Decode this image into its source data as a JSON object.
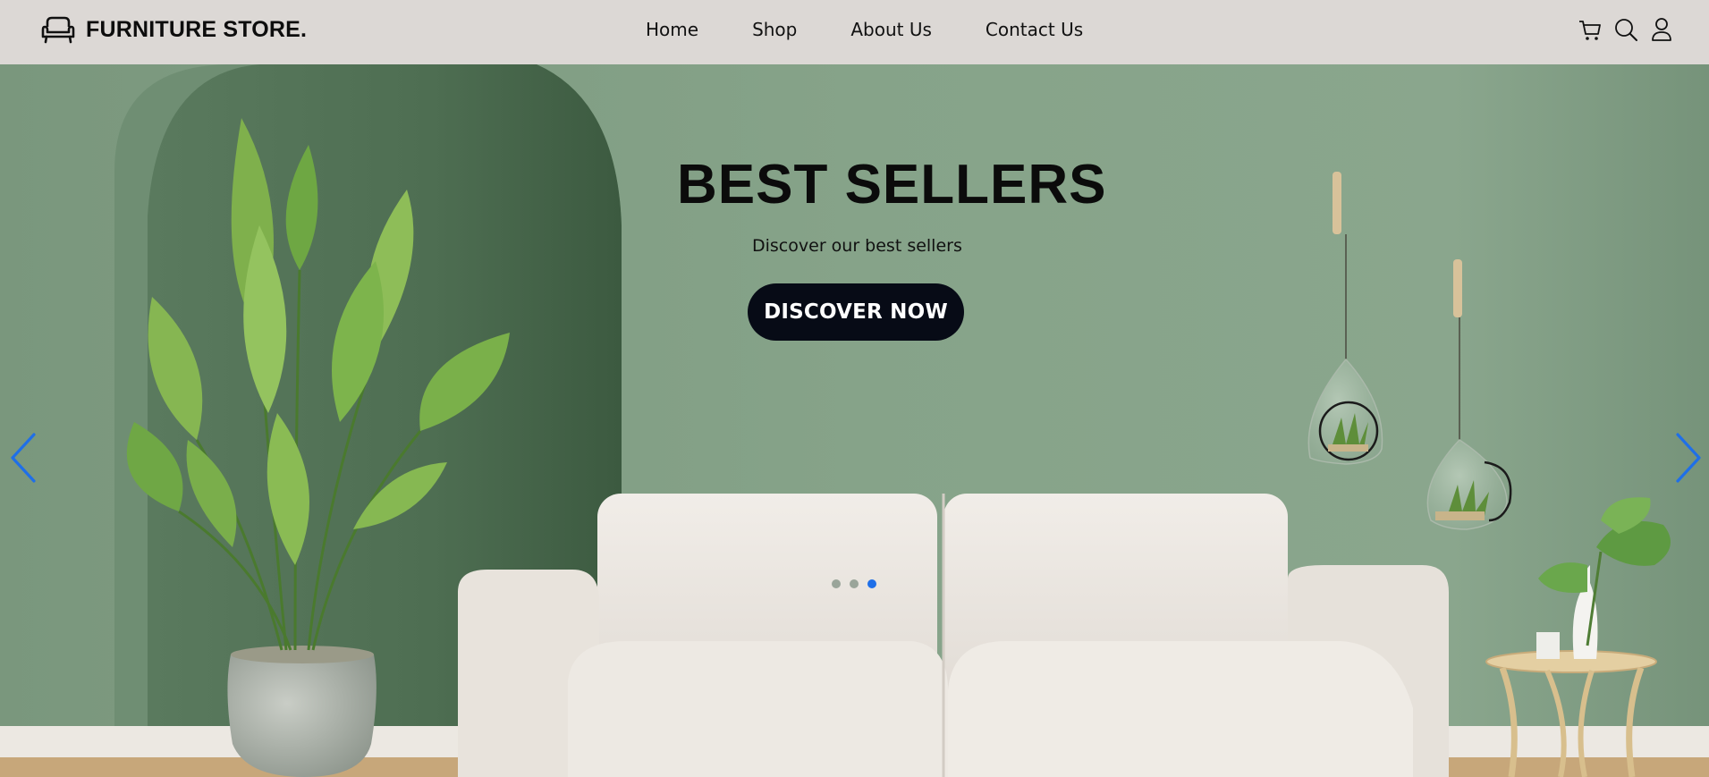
{
  "brand": {
    "name": "FURNITURE STORE."
  },
  "nav": {
    "links": [
      {
        "label": "Home"
      },
      {
        "label": "Shop"
      },
      {
        "label": "About Us"
      },
      {
        "label": "Contact Us"
      }
    ],
    "icons": [
      "cart-icon",
      "search-icon",
      "user-icon"
    ]
  },
  "hero": {
    "title": "BEST SELLERS",
    "subtitle": "Discover our best sellers",
    "cta_label": "DISCOVER NOW",
    "slide_count": 3,
    "active_slide": 3
  },
  "colors": {
    "navbar_bg": "#dcd8d5",
    "wall_green": "#7f9c82",
    "cta_bg": "#070b16",
    "active_dot": "#1f6fe8",
    "arrow": "#1f6fe8"
  }
}
